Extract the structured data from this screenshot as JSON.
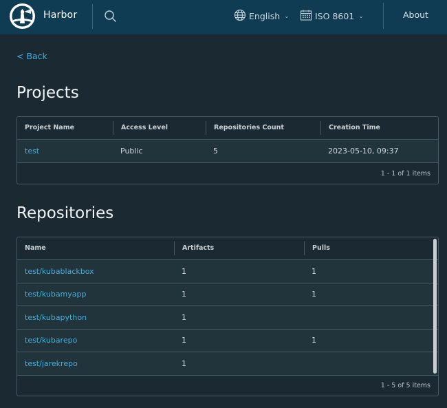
{
  "header": {
    "brand": "Harbor",
    "language": "English",
    "date_format": "ISO 8601",
    "about": "About"
  },
  "nav": {
    "back": "< Back"
  },
  "projects": {
    "title": "Projects",
    "columns": [
      "Project Name",
      "Access Level",
      "Repositories Count",
      "Creation Time"
    ],
    "rows": [
      {
        "name": "test",
        "access": "Public",
        "repo_count": "5",
        "created": "2023-05-10, 09:37"
      }
    ],
    "footer": "1 - 1 of 1 items"
  },
  "repositories": {
    "title": "Repositories",
    "columns": [
      "Name",
      "Artifacts",
      "Pulls"
    ],
    "rows": [
      {
        "name": "test/kubablackbox",
        "artifacts": "1",
        "pulls": "1"
      },
      {
        "name": "test/kubamyapp",
        "artifacts": "1",
        "pulls": "1"
      },
      {
        "name": "test/kubapython",
        "artifacts": "1",
        "pulls": ""
      },
      {
        "name": "test/kubarepo",
        "artifacts": "1",
        "pulls": "1"
      },
      {
        "name": "test/jarekrepo",
        "artifacts": "1",
        "pulls": ""
      }
    ],
    "footer": "1 - 5 of 5 items"
  }
}
